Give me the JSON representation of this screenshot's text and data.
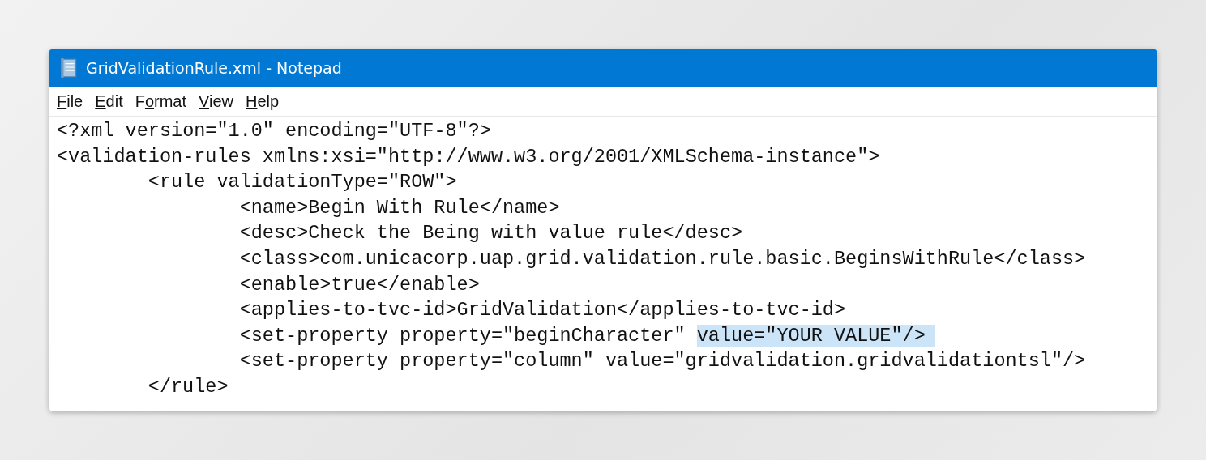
{
  "window": {
    "title": "GridValidationRule.xml - Notepad"
  },
  "menu": [
    {
      "key": "F",
      "after": "ile"
    },
    {
      "key": "E",
      "after": "dit"
    },
    {
      "before": "F",
      "key": "o",
      "after": "rmat"
    },
    {
      "key": "V",
      "after": "iew"
    },
    {
      "key": "H",
      "after": "elp"
    }
  ],
  "lines": [
    {
      "text": "<?xml version=\"1.0\" encoding=\"UTF-8\"?>"
    },
    {
      "text": "<validation-rules xmlns:xsi=\"http://www.w3.org/2001/XMLSchema-instance\">",
      "children": [
        {
          "text": "<rule validationType=\"ROW\">",
          "children": [
            {
              "text": "<name>Begin With Rule</name>"
            },
            {
              "text": "<desc>Check the Being with value rule</desc>"
            },
            {
              "text": "<class>com.unicacorp.uap.grid.validation.rule.basic.BeginsWithRule</class>"
            },
            {
              "text": "<enable>true</enable>"
            },
            {
              "text": "<applies-to-tvc-id>GridValidation</applies-to-tvc-id>"
            },
            {
              "text": "<set-property property=\"beginCharacter\" ",
              "selected_text": "value=\"YOUR VALUE\"/>"
            },
            {
              "text": "<set-property property=\"column\" value=\"gridvalidation.gridvalidationtsl\"/>"
            }
          ]
        },
        {
          "text": "</rule>"
        }
      ]
    }
  ]
}
